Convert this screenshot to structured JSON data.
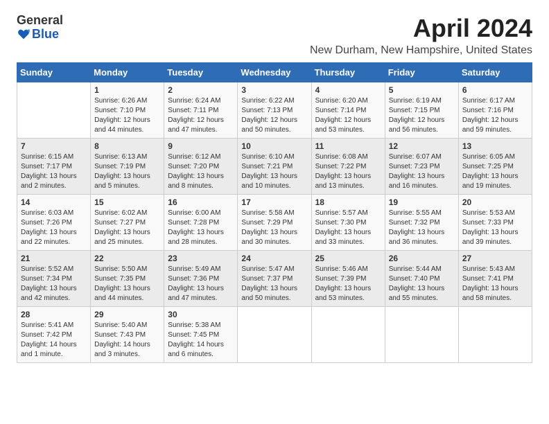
{
  "logo": {
    "general": "General",
    "blue": "Blue"
  },
  "title": "April 2024",
  "location": "New Durham, New Hampshire, United States",
  "days": [
    "Sunday",
    "Monday",
    "Tuesday",
    "Wednesday",
    "Thursday",
    "Friday",
    "Saturday"
  ],
  "weeks": [
    [
      {
        "day": "",
        "content": ""
      },
      {
        "day": "1",
        "content": "Sunrise: 6:26 AM\nSunset: 7:10 PM\nDaylight: 12 hours\nand 44 minutes."
      },
      {
        "day": "2",
        "content": "Sunrise: 6:24 AM\nSunset: 7:11 PM\nDaylight: 12 hours\nand 47 minutes."
      },
      {
        "day": "3",
        "content": "Sunrise: 6:22 AM\nSunset: 7:13 PM\nDaylight: 12 hours\nand 50 minutes."
      },
      {
        "day": "4",
        "content": "Sunrise: 6:20 AM\nSunset: 7:14 PM\nDaylight: 12 hours\nand 53 minutes."
      },
      {
        "day": "5",
        "content": "Sunrise: 6:19 AM\nSunset: 7:15 PM\nDaylight: 12 hours\nand 56 minutes."
      },
      {
        "day": "6",
        "content": "Sunrise: 6:17 AM\nSunset: 7:16 PM\nDaylight: 12 hours\nand 59 minutes."
      }
    ],
    [
      {
        "day": "7",
        "content": "Sunrise: 6:15 AM\nSunset: 7:17 PM\nDaylight: 13 hours\nand 2 minutes."
      },
      {
        "day": "8",
        "content": "Sunrise: 6:13 AM\nSunset: 7:19 PM\nDaylight: 13 hours\nand 5 minutes."
      },
      {
        "day": "9",
        "content": "Sunrise: 6:12 AM\nSunset: 7:20 PM\nDaylight: 13 hours\nand 8 minutes."
      },
      {
        "day": "10",
        "content": "Sunrise: 6:10 AM\nSunset: 7:21 PM\nDaylight: 13 hours\nand 10 minutes."
      },
      {
        "day": "11",
        "content": "Sunrise: 6:08 AM\nSunset: 7:22 PM\nDaylight: 13 hours\nand 13 minutes."
      },
      {
        "day": "12",
        "content": "Sunrise: 6:07 AM\nSunset: 7:23 PM\nDaylight: 13 hours\nand 16 minutes."
      },
      {
        "day": "13",
        "content": "Sunrise: 6:05 AM\nSunset: 7:25 PM\nDaylight: 13 hours\nand 19 minutes."
      }
    ],
    [
      {
        "day": "14",
        "content": "Sunrise: 6:03 AM\nSunset: 7:26 PM\nDaylight: 13 hours\nand 22 minutes."
      },
      {
        "day": "15",
        "content": "Sunrise: 6:02 AM\nSunset: 7:27 PM\nDaylight: 13 hours\nand 25 minutes."
      },
      {
        "day": "16",
        "content": "Sunrise: 6:00 AM\nSunset: 7:28 PM\nDaylight: 13 hours\nand 28 minutes."
      },
      {
        "day": "17",
        "content": "Sunrise: 5:58 AM\nSunset: 7:29 PM\nDaylight: 13 hours\nand 30 minutes."
      },
      {
        "day": "18",
        "content": "Sunrise: 5:57 AM\nSunset: 7:30 PM\nDaylight: 13 hours\nand 33 minutes."
      },
      {
        "day": "19",
        "content": "Sunrise: 5:55 AM\nSunset: 7:32 PM\nDaylight: 13 hours\nand 36 minutes."
      },
      {
        "day": "20",
        "content": "Sunrise: 5:53 AM\nSunset: 7:33 PM\nDaylight: 13 hours\nand 39 minutes."
      }
    ],
    [
      {
        "day": "21",
        "content": "Sunrise: 5:52 AM\nSunset: 7:34 PM\nDaylight: 13 hours\nand 42 minutes."
      },
      {
        "day": "22",
        "content": "Sunrise: 5:50 AM\nSunset: 7:35 PM\nDaylight: 13 hours\nand 44 minutes."
      },
      {
        "day": "23",
        "content": "Sunrise: 5:49 AM\nSunset: 7:36 PM\nDaylight: 13 hours\nand 47 minutes."
      },
      {
        "day": "24",
        "content": "Sunrise: 5:47 AM\nSunset: 7:37 PM\nDaylight: 13 hours\nand 50 minutes."
      },
      {
        "day": "25",
        "content": "Sunrise: 5:46 AM\nSunset: 7:39 PM\nDaylight: 13 hours\nand 53 minutes."
      },
      {
        "day": "26",
        "content": "Sunrise: 5:44 AM\nSunset: 7:40 PM\nDaylight: 13 hours\nand 55 minutes."
      },
      {
        "day": "27",
        "content": "Sunrise: 5:43 AM\nSunset: 7:41 PM\nDaylight: 13 hours\nand 58 minutes."
      }
    ],
    [
      {
        "day": "28",
        "content": "Sunrise: 5:41 AM\nSunset: 7:42 PM\nDaylight: 14 hours\nand 1 minute."
      },
      {
        "day": "29",
        "content": "Sunrise: 5:40 AM\nSunset: 7:43 PM\nDaylight: 14 hours\nand 3 minutes."
      },
      {
        "day": "30",
        "content": "Sunrise: 5:38 AM\nSunset: 7:45 PM\nDaylight: 14 hours\nand 6 minutes."
      },
      {
        "day": "",
        "content": ""
      },
      {
        "day": "",
        "content": ""
      },
      {
        "day": "",
        "content": ""
      },
      {
        "day": "",
        "content": ""
      }
    ]
  ]
}
